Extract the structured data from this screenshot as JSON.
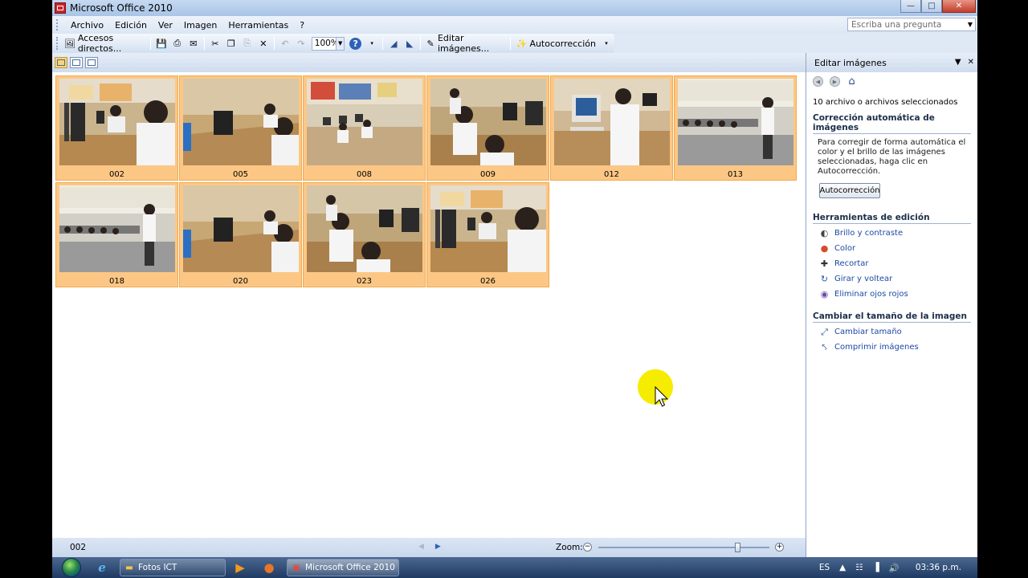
{
  "window": {
    "title": "Microsoft Office 2010"
  },
  "menu": [
    "Archivo",
    "Edición",
    "Ver",
    "Imagen",
    "Herramientas",
    "?"
  ],
  "ask": {
    "placeholder": "Escriba una pregunta"
  },
  "toolbar": {
    "shortcuts_label": "Accesos directos...",
    "zoom_value": "100%",
    "edit_label": "Editar imágenes...",
    "autocorrect_label": "Autocorrección"
  },
  "thumbnails": [
    {
      "label": "002",
      "scene": 0
    },
    {
      "label": "005",
      "scene": 1
    },
    {
      "label": "008",
      "scene": 2
    },
    {
      "label": "009",
      "scene": 3
    },
    {
      "label": "012",
      "scene": 4
    },
    {
      "label": "013",
      "scene": 5
    },
    {
      "label": "018",
      "scene": 5
    },
    {
      "label": "020",
      "scene": 1
    },
    {
      "label": "023",
      "scene": 3
    },
    {
      "label": "026",
      "scene": 0
    }
  ],
  "status": {
    "current_file": "002",
    "zoom_label": "Zoom:"
  },
  "pane": {
    "title": "Editar imágenes",
    "selected_info": "10 archivo o archivos seleccionados",
    "autocorrect_section": "Corrección automática de imágenes",
    "autocorrect_text": "Para corregir de forma automática el color y el brillo de las imágenes seleccionadas, haga clic en Autocorrección.",
    "autocorrect_button": "Autocorrección",
    "tools_section": "Herramientas de edición",
    "tools": [
      {
        "label": "Brillo y contraste",
        "icon": "brightness-icon"
      },
      {
        "label": "Color",
        "icon": "color-icon"
      },
      {
        "label": "Recortar",
        "icon": "crop-icon"
      },
      {
        "label": "Girar y voltear",
        "icon": "rotate-icon"
      },
      {
        "label": "Eliminar ojos rojos",
        "icon": "red-eye-icon"
      }
    ],
    "resize_section": "Cambiar el tamaño de la imagen",
    "resize_tools": [
      {
        "label": "Cambiar tamaño",
        "icon": "resize-icon"
      },
      {
        "label": "Comprimir imágenes",
        "icon": "compress-icon"
      }
    ]
  },
  "taskbar": {
    "tasks": [
      {
        "label": "Fotos ICT",
        "icon": "folder-icon"
      },
      {
        "label": "Microsoft Office 2010",
        "icon": "picture-manager-icon"
      }
    ],
    "language": "ES",
    "clock": "03:36 p.m."
  }
}
